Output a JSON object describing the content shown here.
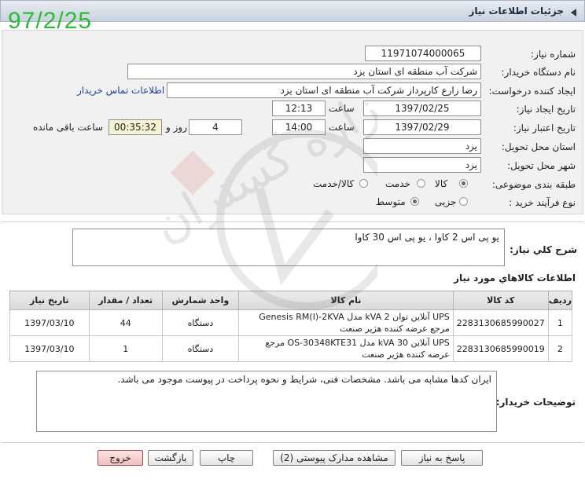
{
  "window": {
    "title": "جزئیات اطلاعات نیاز"
  },
  "stamp": "97/2/25",
  "form": {
    "need_number_label": "شماره نیاز:",
    "need_number": "11971074000065",
    "buyer_label": "نام دستگاه خریدار:",
    "buyer": "شرکت آب منطقه ای استان یزد",
    "creator_label": "ایجاد کننده درخواست:",
    "creator": "رضا زارع کارپرداز شرکت آب منطقه ای استان یزد",
    "contact_link": "اطلاعات تماس خریدار",
    "created_label": "تاریخ ایجاد نیاز:",
    "created_date": "1397/02/25",
    "time_label": "ساعت",
    "created_time": "12:13",
    "valid_label": "تاریخ اعتبار نیاز:",
    "valid_date": "1397/02/29",
    "valid_time": "14:00",
    "days": "4",
    "days_label": "روز و",
    "remaining": "00:35:32",
    "remaining_label": "ساعت باقی مانده",
    "province_label": "استان محل تحویل:",
    "province": "یزد",
    "city_label": "شهر محل تحویل:",
    "city": "یزد",
    "category_label": "طبقه بندی موضوعی:",
    "category_options": [
      "کالا",
      "خدمت",
      "کالا/خدمت"
    ],
    "category_selected": "کالا",
    "process_label": "نوع فرآیند خرید :",
    "process_options": [
      "جزیی",
      "متوسط"
    ],
    "process_selected": "متوسط"
  },
  "description": {
    "label": "شرح كلي نياز:",
    "text": "یو پی اس 2 کاوا ، یو پی اس 30 کاوا"
  },
  "items_section": {
    "title": "اطلاعات كالاهاي مورد نياز",
    "columns": [
      "ردیف",
      "کد کالا",
      "نام کالا",
      "واحد شمارش",
      "تعداد / مقدار",
      "تاریخ نیاز"
    ],
    "rows": [
      {
        "row": "1",
        "code": "2283130685990027",
        "name": "UPS آنلاین توان 2 kVA مدل Genesis RM(I)-2KVA مرجع عرضه کننده هژیر صنعت",
        "unit": "دستگاه",
        "qty": "44",
        "date": "1397/03/10"
      },
      {
        "row": "2",
        "code": "2283130685990019",
        "name": "UPS آنلاین 30 kVA مدل OS-30348KTE31 مرجع عرضه کننده هژیر صنعت",
        "unit": "دستگاه",
        "qty": "1",
        "date": "1397/03/10"
      }
    ]
  },
  "notes": {
    "label": "توضیحات خریدار:",
    "text": "ایران کدها مشابه می باشد. مشخصات فنی، شرایط و نحوه پرداخت در پیوست موجود می باشد."
  },
  "buttons": {
    "reply": "پاسخ به نیاز",
    "attachments": "مشاهده مدارک پیوستی (2)",
    "print": "چاپ",
    "back": "بازگشت",
    "exit": "خروج"
  },
  "watermark_text": "هزاره گستران",
  "colors": {
    "stamp": "#2dbb34",
    "link": "#1b3fa7",
    "exit_button": "#f0c0c0"
  }
}
